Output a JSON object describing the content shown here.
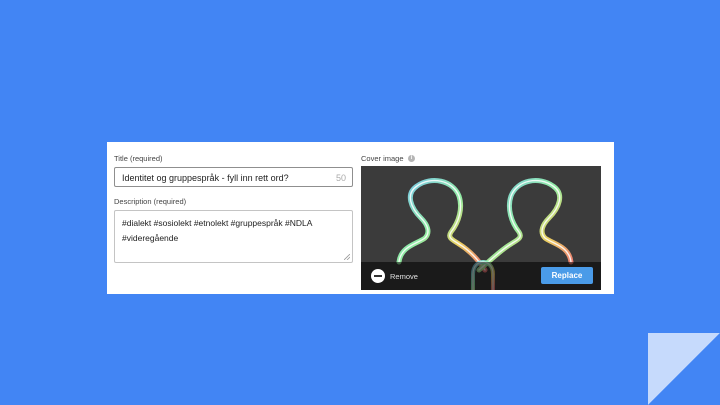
{
  "form": {
    "title_label": "Title (required)",
    "title_value": "Identitet og gruppespråk - fyll inn rett ord?",
    "title_counter": "50",
    "description_label": "Description (required)",
    "description_value": "#dialekt #sosiolekt #etnolekt #gruppespråk #NDLA #videregående"
  },
  "cover": {
    "label": "Cover image",
    "info_glyph": "i",
    "remove_label": "Remove",
    "replace_label": "Replace"
  },
  "colors": {
    "background": "#4285f4",
    "replace_button": "#4a9be8"
  }
}
